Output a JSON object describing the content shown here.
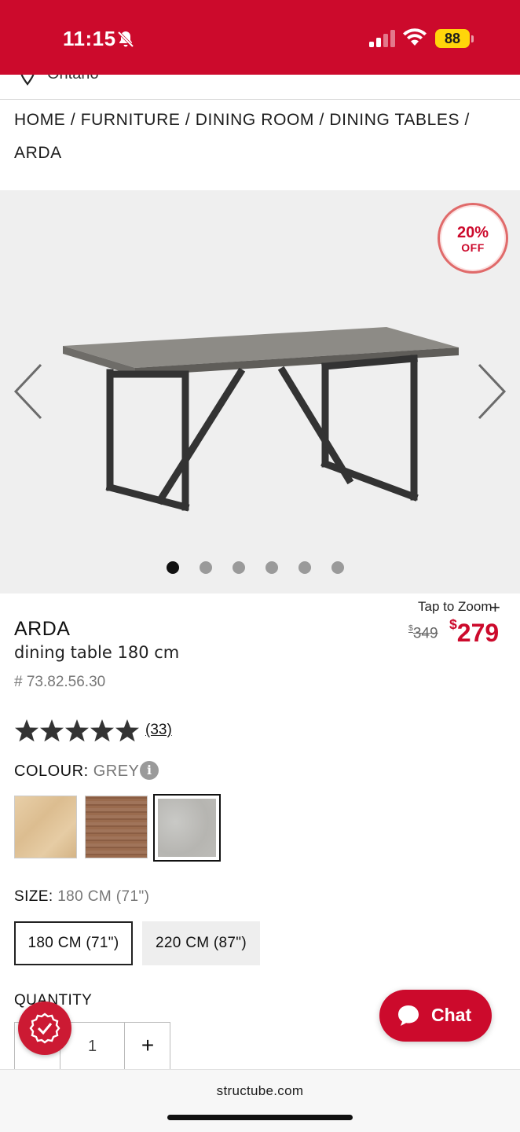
{
  "status_bar": {
    "time": "11:15",
    "battery": "88",
    "icons": [
      "bell-slash-icon",
      "signal-icon",
      "wifi-icon",
      "battery-icon"
    ]
  },
  "location": {
    "text": "Ontario",
    "icon": "location-pin-icon"
  },
  "breadcrumb": {
    "items": [
      "HOME",
      "FURNITURE",
      "DINING ROOM",
      "DINING TABLES",
      "ARDA"
    ],
    "separator": "/"
  },
  "carousel": {
    "badge_pct": "20%",
    "badge_off": "OFF",
    "image_count": 6,
    "active_index": 0,
    "icons": [
      "chevron-left-icon",
      "chevron-right-icon"
    ]
  },
  "product": {
    "zoom_label": "Tap to Zoom",
    "zoom_plus": "+",
    "name": "ARDA",
    "description": "dining table 180 cm",
    "sku": "# 73.82.56.30",
    "old_price_symbol": "$",
    "old_price": "349",
    "new_price_symbol": "$",
    "new_price": "279",
    "rating": 5,
    "review_count": "(33)"
  },
  "colour": {
    "label": "COLOUR:",
    "value": "GREY",
    "info": "i",
    "options": [
      "natural",
      "walnut",
      "grey"
    ],
    "selected": "grey"
  },
  "size": {
    "label": "SIZE:",
    "value": "180 CM (71\")",
    "options": [
      "180 CM (71\")",
      "220 CM (87\")"
    ],
    "selected": "180 CM (71\")"
  },
  "quantity": {
    "label": "QUANTITY",
    "value": "1",
    "plus": "+"
  },
  "chat": {
    "label": "Chat"
  },
  "browser": {
    "url": "structube.com"
  },
  "colors": {
    "brand_red": "#cc0a2c",
    "battery_yellow": "#ffd60a"
  }
}
